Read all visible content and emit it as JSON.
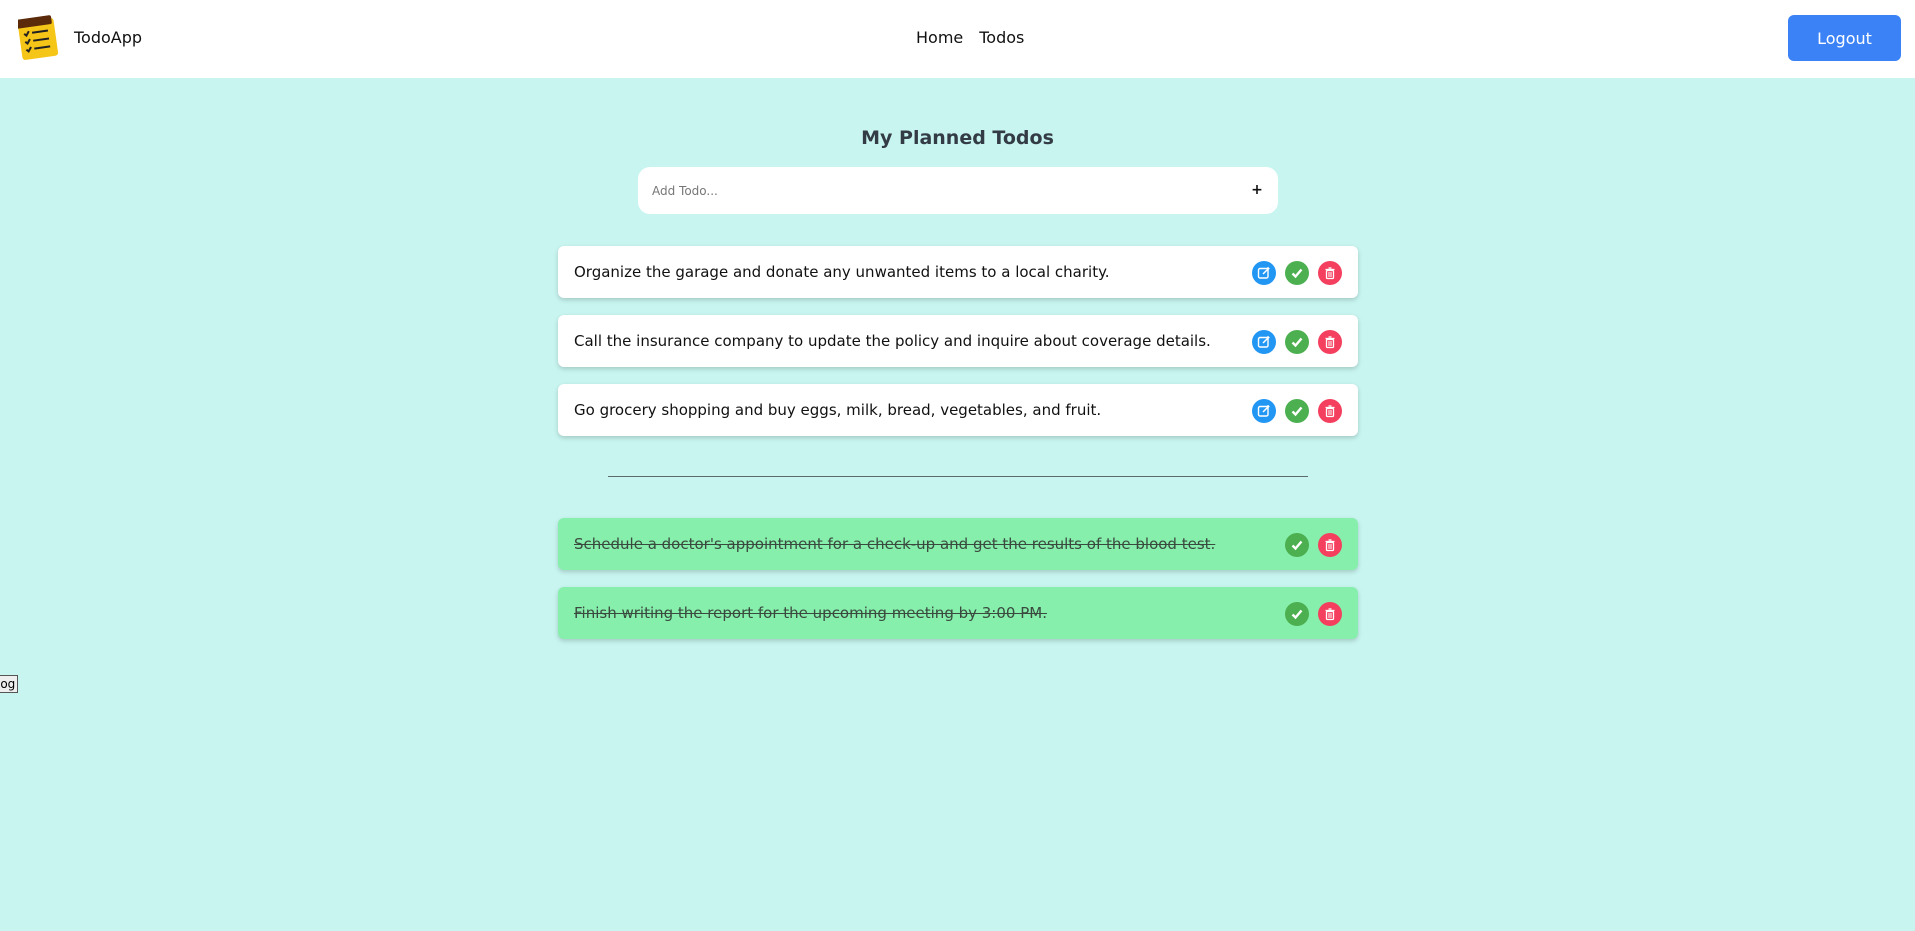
{
  "header": {
    "brand": "TodoApp",
    "nav": [
      "Home",
      "Todos"
    ],
    "logout_label": "Logout"
  },
  "main": {
    "title": "My Planned Todos",
    "add_placeholder": "Add Todo...",
    "add_button": "+",
    "todos": [
      "Organize the garage and donate any unwanted items to a local charity.",
      "Call the insurance company to update the policy and inquire about coverage details.",
      "Go grocery shopping and buy eggs, milk, bread, vegetables, and fruit."
    ],
    "completed": [
      "Schedule a doctor's appointment for a check-up and get the results of the blood test.",
      "Finish writing the report for the upcoming meeting by 3:00 PM."
    ]
  },
  "log_button": "log",
  "colors": {
    "background": "#c8f5f0",
    "accent": "#3b82f6",
    "edit": "#2196f3",
    "done": "#4caf50",
    "delete": "#f43f5e",
    "completed_bg": "#86efac"
  },
  "icons": [
    "notepad-logo-icon",
    "edit-icon",
    "check-icon",
    "trash-icon"
  ]
}
